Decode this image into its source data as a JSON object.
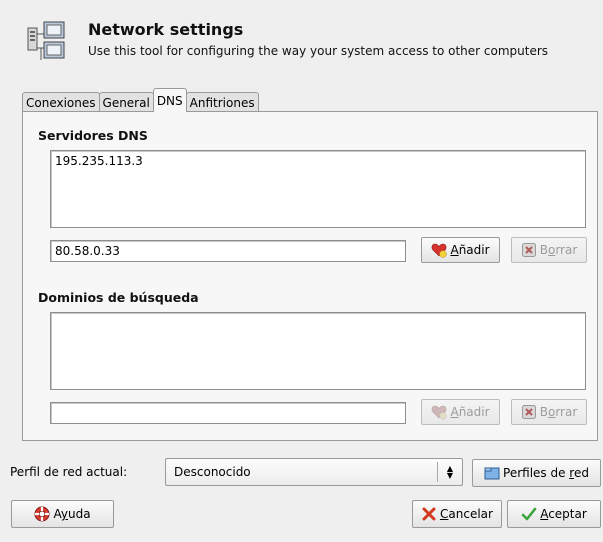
{
  "header": {
    "title": "Network settings",
    "subtitle": "Use this tool for configuring the way your system access to other computers"
  },
  "tabs": [
    {
      "label": "Conexiones",
      "active": false
    },
    {
      "label": "General",
      "active": false
    },
    {
      "label": "DNS",
      "active": true
    },
    {
      "label": "Anfitriones",
      "active": false
    }
  ],
  "dns": {
    "section_title": "Servidores DNS",
    "servers": [
      "195.235.113.3"
    ],
    "entry_value": "80.58.0.33",
    "add_label_u": "A",
    "add_label_rest": "ñadir",
    "delete_label_pre": "B",
    "delete_label_u": "o",
    "delete_label_rest": "rrar"
  },
  "search": {
    "section_title": "Dominios de búsqueda",
    "domains": [],
    "entry_value": "",
    "add_label_u": "A",
    "add_label_rest": "ñadir",
    "delete_label_pre": "B",
    "delete_label_u": "o",
    "delete_label_rest": "rrar"
  },
  "profile": {
    "label": "Perfil de red actual:",
    "selected": "Desconocido",
    "profiles_btn_pre": "Perfiles de ",
    "profiles_btn_u": "r",
    "profiles_btn_rest": "ed"
  },
  "footer": {
    "help_pre": "A",
    "help_u": "y",
    "help_rest": "uda",
    "cancel_u": "C",
    "cancel_rest": "ancelar",
    "ok_u": "A",
    "ok_rest": "ceptar"
  },
  "colors": {
    "accept_check": "#3aa53a",
    "cancel_x": "#d23a1e",
    "heart": "#d6332f"
  }
}
